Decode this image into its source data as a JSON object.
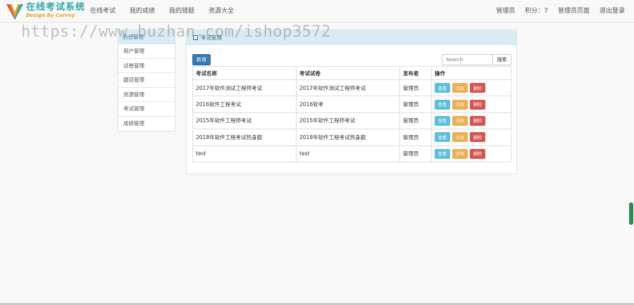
{
  "brand": {
    "title": "在线考试系统",
    "subtitle": "Design By Corvey"
  },
  "nav": {
    "left": [
      "在线考试",
      "我的成绩",
      "我的错题",
      "资源大全"
    ],
    "user": "管理员",
    "score": "积分：7",
    "admin_page": "管理员页面",
    "logout": "退出登录"
  },
  "sidebar": {
    "header": "后台管理",
    "items": [
      "用户管理",
      "试卷管理",
      "题目管理",
      "资源管理",
      "考试管理",
      "成绩管理"
    ]
  },
  "panel": {
    "header": "考试管理",
    "add_button": "新增",
    "search_placeholder": "Search",
    "search_button": "搜索",
    "columns": [
      "考试名称",
      "考试试卷",
      "发布者",
      "操作"
    ],
    "rows": [
      [
        "2017年软件测试工程师考试",
        "2017年软件测试工程师考试",
        "管理员"
      ],
      [
        "2016软件工程考试",
        "2016软考",
        "管理员"
      ],
      [
        "2015年软件工程师考试",
        "2015年软件工程师考试",
        "管理员"
      ],
      [
        "2018年软件工程考试热身题",
        "2018年软件工程考试热身题",
        "管理员"
      ],
      [
        "test",
        "test",
        "管理员"
      ]
    ],
    "ops": {
      "view": "查看",
      "edit": "修改",
      "delete": "删除"
    }
  },
  "watermark": "https://www.huzhan.com/ishop3572",
  "colors": {
    "primary": "#337ab7",
    "info": "#5bc0de",
    "warning": "#f0ad4e",
    "danger": "#d9534f",
    "brand": "#2fa6a8"
  }
}
